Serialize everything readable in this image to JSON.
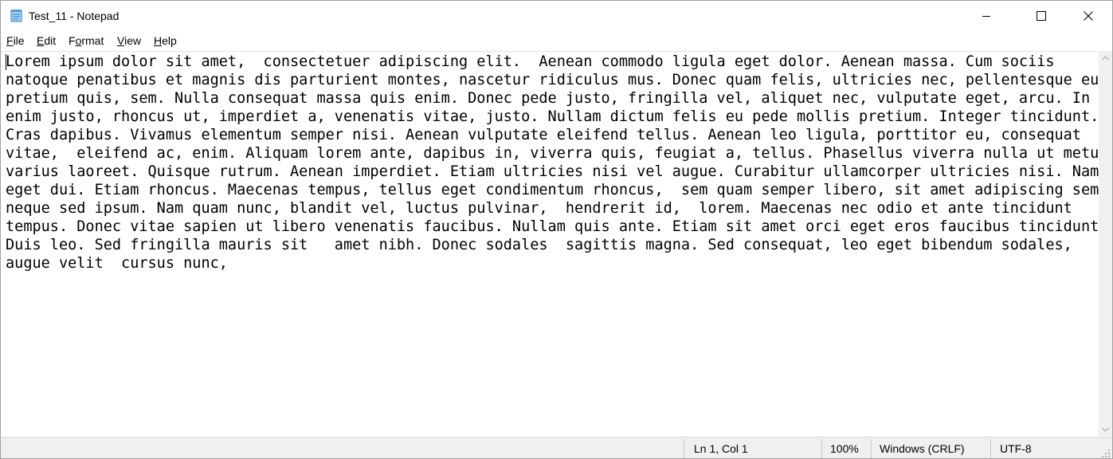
{
  "window": {
    "title": "Test_11 - Notepad"
  },
  "menu": {
    "items": [
      {
        "acc": "F",
        "rest": "ile"
      },
      {
        "acc": "E",
        "rest": "dit"
      },
      {
        "acc": "",
        "pre": "F",
        "accmid": "o",
        "rest": "rmat"
      },
      {
        "acc": "V",
        "rest": "iew"
      },
      {
        "acc": "H",
        "rest": "elp"
      }
    ]
  },
  "editor": {
    "lines": [
      "Lorem ipsum dolor sit amet,  consectetuer adipiscing elit.  Aenean commodo ligula eget dolor. Aenean massa. Cum sociis",
      "natoque penatibus et magnis dis parturient montes, nascetur ridiculus mus. Donec quam felis, ultricies nec, pellentesque eu,",
      "pretium quis, sem. Nulla consequat massa quis enim. Donec pede justo, fringilla vel, aliquet nec, vulputate eget, arcu. In",
      "enim justo, rhoncus ut, imperdiet a, venenatis vitae, justo. Nullam dictum felis eu pede mollis pretium. Integer tincidunt.",
      "Cras dapibus. Vivamus elementum semper nisi. Aenean vulputate eleifend tellus. Aenean leo ligula, porttitor eu, consequat",
      "vitae,  eleifend ac, enim. Aliquam lorem ante, dapibus in, viverra quis, feugiat a, tellus. Phasellus viverra nulla ut metus",
      "varius laoreet. Quisque rutrum. Aenean imperdiet. Etiam ultricies nisi vel augue. Curabitur ullamcorper ultricies nisi. Nam",
      "eget dui. Etiam rhoncus. Maecenas tempus, tellus eget condimentum rhoncus,  sem quam semper libero, sit amet adipiscing sem",
      "neque sed ipsum. Nam quam nunc, blandit vel, luctus pulvinar,  hendrerit id,  lorem. Maecenas nec odio et ante tincidunt",
      "tempus. Donec vitae sapien ut libero venenatis faucibus. Nullam quis ante. Etiam sit amet orci eget eros faucibus tincidunt.",
      "Duis leo. Sed fringilla mauris sit   amet nibh. Donec sodales  sagittis magna. Sed consequat, leo eget bibendum sodales,",
      "augue velit  cursus nunc,"
    ]
  },
  "status": {
    "position": "Ln 1, Col 1",
    "zoom": "100%",
    "line_ending": "Windows (CRLF)",
    "encoding": "UTF-8"
  }
}
